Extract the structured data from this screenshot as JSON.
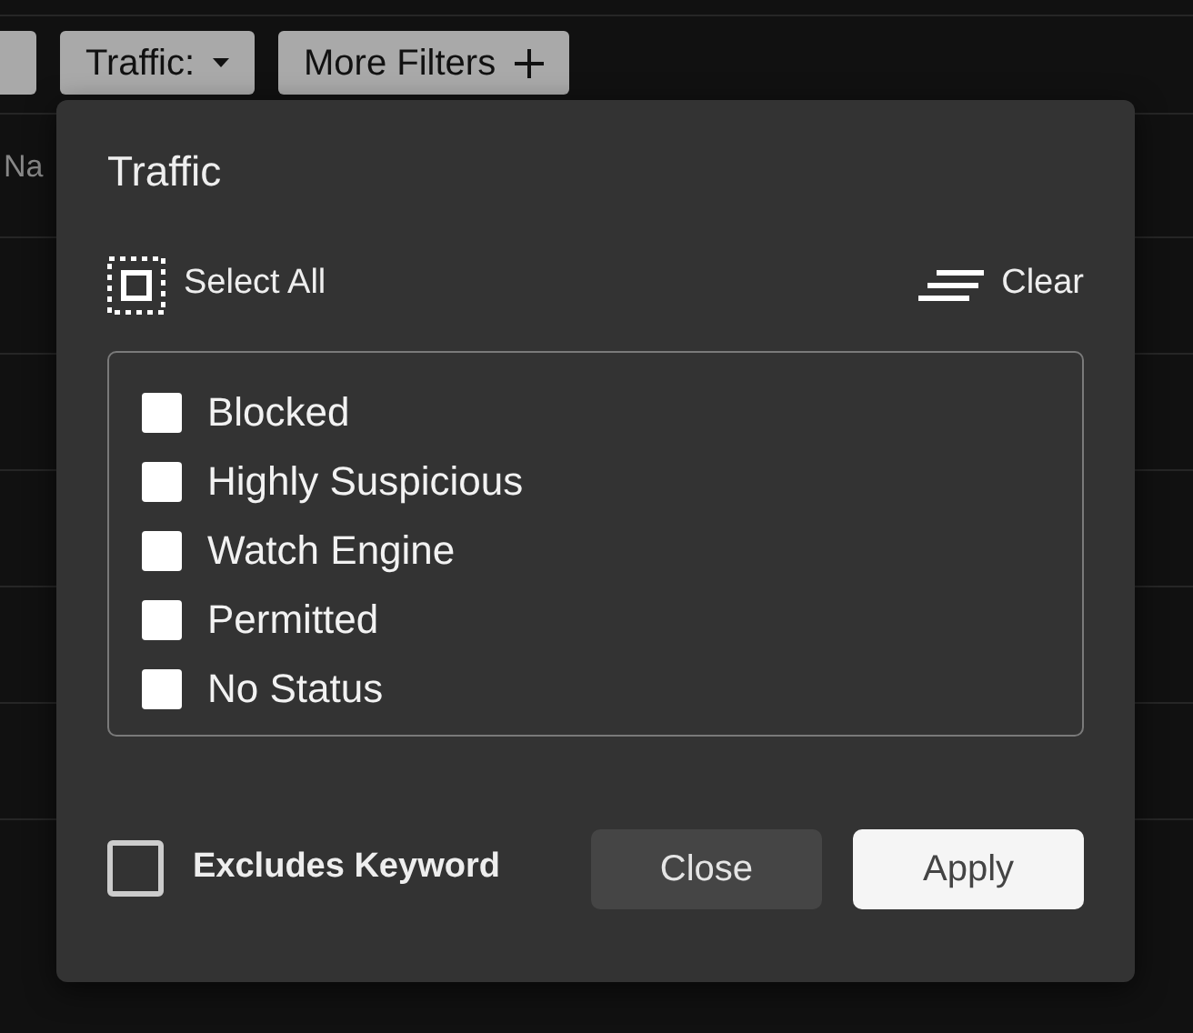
{
  "toolbar": {
    "buttons": [
      {
        "label": "Traffic:",
        "kind": "dropdown"
      },
      {
        "label": "More Filters",
        "kind": "add"
      }
    ]
  },
  "table": {
    "columns": [
      "Na"
    ]
  },
  "popup": {
    "title": "Traffic",
    "select_all": "Select All",
    "clear": "Clear",
    "options": [
      {
        "label": "Blocked",
        "checked": false
      },
      {
        "label": "Highly Suspicious",
        "checked": false
      },
      {
        "label": "Watch Engine",
        "checked": false
      },
      {
        "label": "Permitted",
        "checked": false
      },
      {
        "label": "No Status",
        "checked": false
      }
    ],
    "excludes_keyword": {
      "label": "Excludes Keyword",
      "checked": false
    },
    "buttons": [
      {
        "label": "Close",
        "kind": "secondary"
      },
      {
        "label": "Apply",
        "kind": "primary"
      }
    ]
  }
}
